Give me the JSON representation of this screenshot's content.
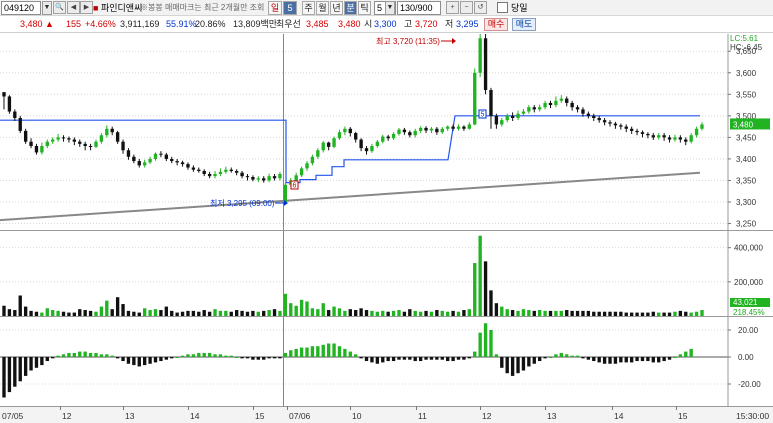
{
  "toolbar": {
    "stock_code": "049120",
    "name": "파인디앤씨",
    "notice": "※봉봉 매매마크는 최근 2개월만 조회",
    "periods": [
      {
        "label": "일",
        "selected": false,
        "red": true
      },
      {
        "label": "5",
        "selected": true,
        "red": false
      },
      {
        "label": "주",
        "selected": false,
        "red": false
      },
      {
        "label": "월",
        "selected": false,
        "red": false
      },
      {
        "label": "년",
        "selected": false,
        "red": false
      },
      {
        "label": "분",
        "selected": false,
        "red": false
      },
      {
        "label": "틱",
        "selected": false,
        "red": false
      }
    ],
    "interval_value": "5",
    "count_value": "130/900",
    "today_label": "당일"
  },
  "quote": {
    "price": "3,480",
    "change": "155",
    "change_pct": "+4.66%",
    "volume": "3,911,169",
    "rate1": "55.91%",
    "rate2": "20.86%",
    "amount": "13,809백만",
    "pref_label": "최우선",
    "bid1": "3,485",
    "bid2": "3,480",
    "open_label": "시",
    "open": "3,300",
    "high_label": "고",
    "high": "3,720",
    "low_label": "저",
    "low": "3,295",
    "buy_label": "매수",
    "sell_label": "매도"
  },
  "chart": {
    "top_right": {
      "lc": "LC:5.61",
      "hc": "HC:-6.45"
    },
    "price_ticks": [
      "3,650",
      "3,600",
      "3,550",
      "3,500",
      "3,450",
      "3,400",
      "3,350",
      "3,300",
      "3,250"
    ],
    "price_tag": "3,480",
    "volume_ticks": [
      "400,000",
      "200,000"
    ],
    "volume_tags": [
      "43,021",
      "218.45%"
    ],
    "osc_ticks": [
      "20.00",
      "0.00",
      "-20.00"
    ],
    "high_marker": "최고 3,720 (11:35)",
    "low_marker": "최저 3,295 (09:00)",
    "badge_a": "6",
    "badge_b": "5",
    "x_labels": [
      "07/05",
      "12",
      "13",
      "14",
      "15",
      "07/06",
      "10",
      "11",
      "12",
      "13",
      "14",
      "15",
      "15:30:00"
    ],
    "colors": {
      "up": "#22b322",
      "down": "#111111",
      "ma_blue": "#2255ee",
      "ma_gray": "#888888",
      "divider": "#e06060"
    }
  },
  "chart_data": {
    "type": "candlestick",
    "candles": [
      [
        3555,
        3545,
        3555,
        3515
      ],
      [
        3545,
        3510,
        3548,
        3505
      ],
      [
        3510,
        3495,
        3515,
        3488
      ],
      [
        3495,
        3465,
        3500,
        3460
      ],
      [
        3465,
        3440,
        3470,
        3435
      ],
      [
        3440,
        3430,
        3448,
        3425
      ],
      [
        3430,
        3415,
        3435,
        3410
      ],
      [
        3415,
        3430,
        3438,
        3410
      ],
      [
        3430,
        3440,
        3445,
        3425
      ],
      [
        3440,
        3445,
        3450,
        3435
      ],
      [
        3445,
        3450,
        3458,
        3440
      ],
      [
        3450,
        3448,
        3455,
        3440
      ],
      [
        3448,
        3445,
        3452,
        3438
      ],
      [
        3445,
        3440,
        3450,
        3432
      ],
      [
        3440,
        3435,
        3445,
        3428
      ],
      [
        3435,
        3430,
        3440,
        3420
      ],
      [
        3430,
        3428,
        3435,
        3420
      ],
      [
        3428,
        3440,
        3445,
        3425
      ],
      [
        3440,
        3455,
        3460,
        3435
      ],
      [
        3455,
        3470,
        3478,
        3450
      ],
      [
        3470,
        3462,
        3475,
        3455
      ],
      [
        3462,
        3440,
        3465,
        3435
      ],
      [
        3440,
        3420,
        3445,
        3412
      ],
      [
        3420,
        3405,
        3425,
        3398
      ],
      [
        3405,
        3395,
        3410,
        3390
      ],
      [
        3395,
        3385,
        3400,
        3380
      ],
      [
        3385,
        3392,
        3398,
        3380
      ],
      [
        3392,
        3400,
        3405,
        3388
      ],
      [
        3400,
        3412,
        3415,
        3396
      ],
      [
        3412,
        3410,
        3418,
        3404
      ],
      [
        3410,
        3400,
        3414,
        3395
      ],
      [
        3400,
        3395,
        3405,
        3390
      ],
      [
        3395,
        3392,
        3400,
        3385
      ],
      [
        3392,
        3388,
        3396,
        3382
      ],
      [
        3388,
        3380,
        3392,
        3375
      ],
      [
        3380,
        3375,
        3385,
        3370
      ],
      [
        3375,
        3372,
        3380,
        3368
      ],
      [
        3372,
        3365,
        3376,
        3360
      ],
      [
        3365,
        3360,
        3370,
        3355
      ],
      [
        3360,
        3365,
        3372,
        3355
      ],
      [
        3365,
        3370,
        3378,
        3360
      ],
      [
        3370,
        3375,
        3382,
        3366
      ],
      [
        3375,
        3372,
        3380,
        3368
      ],
      [
        3372,
        3368,
        3376,
        3362
      ],
      [
        3368,
        3360,
        3372,
        3355
      ],
      [
        3360,
        3358,
        3365,
        3350
      ],
      [
        3358,
        3352,
        3362,
        3348
      ],
      [
        3352,
        3355,
        3360,
        3346
      ],
      [
        3355,
        3350,
        3360,
        3345
      ],
      [
        3350,
        3360,
        3366,
        3346
      ],
      [
        3360,
        3355,
        3365,
        3350
      ],
      [
        3355,
        3365,
        3370,
        3350
      ],
      [
        3300,
        3340,
        3345,
        3295
      ],
      [
        3340,
        3350,
        3356,
        3335
      ],
      [
        3350,
        3362,
        3368,
        3345
      ],
      [
        3362,
        3378,
        3382,
        3358
      ],
      [
        3378,
        3390,
        3395,
        3372
      ],
      [
        3390,
        3405,
        3410,
        3385
      ],
      [
        3405,
        3420,
        3425,
        3400
      ],
      [
        3420,
        3438,
        3442,
        3415
      ],
      [
        3438,
        3428,
        3440,
        3420
      ],
      [
        3428,
        3448,
        3452,
        3425
      ],
      [
        3448,
        3462,
        3468,
        3444
      ],
      [
        3462,
        3470,
        3475,
        3455
      ],
      [
        3470,
        3460,
        3474,
        3452
      ],
      [
        3460,
        3445,
        3463,
        3438
      ],
      [
        3445,
        3425,
        3448,
        3418
      ],
      [
        3425,
        3418,
        3430,
        3410
      ],
      [
        3418,
        3430,
        3435,
        3414
      ],
      [
        3430,
        3440,
        3444,
        3426
      ],
      [
        3440,
        3452,
        3456,
        3436
      ],
      [
        3452,
        3448,
        3456,
        3442
      ],
      [
        3448,
        3458,
        3462,
        3444
      ],
      [
        3458,
        3468,
        3472,
        3454
      ],
      [
        3468,
        3462,
        3472,
        3456
      ],
      [
        3462,
        3455,
        3466,
        3450
      ],
      [
        3455,
        3465,
        3470,
        3450
      ],
      [
        3465,
        3472,
        3476,
        3460
      ],
      [
        3472,
        3466,
        3476,
        3460
      ],
      [
        3466,
        3470,
        3474,
        3460
      ],
      [
        3470,
        3462,
        3474,
        3456
      ],
      [
        3462,
        3470,
        3474,
        3458
      ],
      [
        3470,
        3475,
        3478,
        3465
      ],
      [
        3475,
        3470,
        3480,
        3465
      ],
      [
        3470,
        3475,
        3480,
        3466
      ],
      [
        3475,
        3470,
        3478,
        3465
      ],
      [
        3470,
        3480,
        3485,
        3468
      ],
      [
        3480,
        3600,
        3610,
        3478
      ],
      [
        3600,
        3680,
        3720,
        3590
      ],
      [
        3680,
        3560,
        3690,
        3550
      ],
      [
        3560,
        3500,
        3565,
        3470
      ],
      [
        3500,
        3480,
        3505,
        3470
      ],
      [
        3480,
        3490,
        3495,
        3475
      ],
      [
        3490,
        3500,
        3505,
        3485
      ],
      [
        3500,
        3495,
        3508,
        3488
      ],
      [
        3495,
        3505,
        3512,
        3490
      ],
      [
        3505,
        3510,
        3516,
        3500
      ],
      [
        3510,
        3520,
        3525,
        3505
      ],
      [
        3520,
        3515,
        3525,
        3508
      ],
      [
        3515,
        3520,
        3526,
        3510
      ],
      [
        3520,
        3530,
        3535,
        3515
      ],
      [
        3530,
        3525,
        3535,
        3518
      ],
      [
        3525,
        3535,
        3545,
        3520
      ],
      [
        3535,
        3540,
        3548,
        3530
      ],
      [
        3540,
        3530,
        3545,
        3522
      ],
      [
        3530,
        3520,
        3535,
        3512
      ],
      [
        3520,
        3515,
        3525,
        3508
      ],
      [
        3515,
        3505,
        3520,
        3498
      ],
      [
        3505,
        3500,
        3510,
        3494
      ],
      [
        3500,
        3495,
        3505,
        3488
      ],
      [
        3495,
        3490,
        3500,
        3484
      ],
      [
        3490,
        3485,
        3495,
        3478
      ],
      [
        3485,
        3482,
        3490,
        3475
      ],
      [
        3482,
        3478,
        3486,
        3470
      ],
      [
        3478,
        3475,
        3482,
        3468
      ],
      [
        3475,
        3470,
        3480,
        3462
      ],
      [
        3470,
        3465,
        3475,
        3458
      ],
      [
        3465,
        3462,
        3470,
        3455
      ],
      [
        3462,
        3458,
        3466,
        3450
      ],
      [
        3458,
        3455,
        3462,
        3448
      ],
      [
        3455,
        3450,
        3460,
        3444
      ],
      [
        3450,
        3455,
        3460,
        3445
      ],
      [
        3455,
        3450,
        3460,
        3442
      ],
      [
        3450,
        3445,
        3455,
        3438
      ],
      [
        3445,
        3450,
        3456,
        3440
      ],
      [
        3450,
        3445,
        3455,
        3438
      ],
      [
        3445,
        3440,
        3450,
        3432
      ],
      [
        3440,
        3455,
        3460,
        3436
      ],
      [
        3455,
        3470,
        3475,
        3450
      ],
      [
        3470,
        3480,
        3485,
        3466
      ]
    ],
    "volume": [
      60,
      40,
      35,
      120,
      55,
      30,
      25,
      20,
      45,
      35,
      30,
      25,
      20,
      20,
      40,
      35,
      30,
      25,
      55,
      90,
      40,
      110,
      70,
      30,
      25,
      20,
      45,
      35,
      40,
      35,
      55,
      30,
      20,
      25,
      30,
      30,
      25,
      35,
      25,
      40,
      30,
      30,
      25,
      35,
      30,
      25,
      30,
      25,
      30,
      35,
      40,
      30,
      130,
      75,
      60,
      95,
      85,
      45,
      40,
      75,
      35,
      55,
      45,
      30,
      40,
      35,
      45,
      35,
      30,
      25,
      30,
      25,
      30,
      35,
      25,
      40,
      30,
      25,
      30,
      25,
      35,
      30,
      25,
      30,
      25,
      35,
      40,
      310,
      470,
      320,
      150,
      75,
      55,
      40,
      35,
      30,
      40,
      35,
      30,
      35,
      30,
      30,
      30,
      30,
      35,
      30,
      30,
      30,
      30,
      25,
      25,
      25,
      25,
      25,
      25,
      20,
      20,
      20,
      20,
      20,
      25,
      20,
      20,
      20,
      25,
      30,
      25,
      20,
      25,
      35
    ],
    "osc": [
      -30,
      -26,
      -22,
      -18,
      -14,
      -10,
      -8,
      -6,
      -3,
      -1,
      1,
      2,
      3,
      3,
      4,
      4,
      3,
      3,
      2,
      2,
      1,
      -1,
      -3,
      -5,
      -6,
      -7,
      -6,
      -5,
      -4,
      -3,
      -2,
      -1,
      0,
      1,
      2,
      2,
      3,
      3,
      3,
      2,
      2,
      1,
      1,
      0,
      -1,
      -1,
      -2,
      -2,
      -2,
      -1,
      -1,
      -1,
      3,
      5,
      6,
      7,
      7,
      8,
      8,
      9,
      10,
      10,
      8,
      6,
      4,
      2,
      -1,
      -3,
      -4,
      -5,
      -4,
      -3,
      -3,
      -2,
      -2,
      -2,
      -3,
      -3,
      -2,
      -2,
      -2,
      -2,
      -3,
      -3,
      -2,
      -2,
      -1,
      4,
      18,
      25,
      20,
      2,
      -8,
      -12,
      -14,
      -12,
      -10,
      -7,
      -5,
      -3,
      -1,
      0,
      2,
      3,
      2,
      1,
      1,
      -1,
      -2,
      -3,
      -4,
      -5,
      -5,
      -5,
      -4,
      -4,
      -4,
      -3,
      -3,
      -3,
      -4,
      -4,
      -3,
      -2,
      0,
      2,
      4,
      6
    ]
  }
}
